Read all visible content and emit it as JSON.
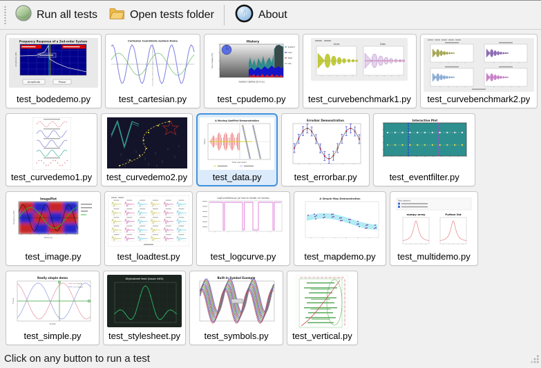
{
  "toolbar": {
    "buttons": [
      {
        "label": "Run all tests",
        "icon": "run-sphere-icon"
      },
      {
        "label": "Open tests folder",
        "icon": "open-folder-icon"
      },
      {
        "label": "About",
        "icon": "about-info-icon"
      }
    ]
  },
  "statusbar": {
    "message": "Click on any button to run a test"
  },
  "colors": {
    "selection_border": "#3f92e0",
    "selection_background": "#dcebfb",
    "card_background": "#ffffff",
    "window_background": "#f0f0f0"
  },
  "grid": {
    "selected_card": "test_data.py",
    "rows": [
      [
        {
          "id": "test_bodedemo.py",
          "label": "test_bodedemo.py",
          "thumb": {
            "title": "Frequency Response of a 2nd-order System",
            "ylabel": "Amplitude [dB]",
            "legend": [
              "Amplitude",
              "Phase"
            ]
          }
        },
        {
          "id": "test_cartesian.py",
          "label": "test_cartesian.py",
          "thumb": {
            "title": "Cartesian Coordinate System Demo"
          }
        },
        {
          "id": "test_cpudemo.py",
          "label": "test_cpudemo.py",
          "thumb": {
            "title": "History",
            "xlabel": "System Uptime [h:m:s]",
            "ylabel": "Cpu Usage [%]",
            "legend": [
              "System",
              "User",
              "Total",
              "Idle"
            ]
          }
        },
        {
          "id": "test_curvebenchmark1.py",
          "label": "test_curvebenchmark1.py",
          "thumb": {
            "titles": [
              "Lines",
              "Dots"
            ]
          }
        },
        {
          "id": "test_curvebenchmark2.py",
          "label": "test_curvebenchmark2.py",
          "thumb": {}
        }
      ],
      [
        {
          "id": "test_curvedemo1.py",
          "label": "test_curvedemo1.py",
          "thumb": {}
        },
        {
          "id": "test_curvedemo2.py",
          "label": "test_curvedemo2.py",
          "thumb": {}
        },
        {
          "id": "test_data.py",
          "label": "test_data.py",
          "selected": true,
          "thumb": {
            "title": "A Moving QwtPlot Demonstration",
            "xlabel": "Time (seconds)",
            "ylabel": "Values"
          }
        },
        {
          "id": "test_errorbar.py",
          "label": "test_errorbar.py",
          "thumb": {
            "title": "Errorbar Demonstration"
          }
        },
        {
          "id": "test_eventfilter.py",
          "label": "test_eventfilter.py",
          "thumb": {
            "title": "Interactive Plot"
          }
        }
      ],
      [
        {
          "id": "test_image.py",
          "label": "test_image.py",
          "thumb": {
            "title": "ImagePlot",
            "xlabel": "time (s)",
            "ylabel": "Frequency (Hz)"
          }
        },
        {
          "id": "test_loadtest.py",
          "label": "test_loadtest.py",
          "thumb": {}
        },
        {
          "id": "test_logcurve.py",
          "label": "test_logcurve.py",
          "thumb": {
            "title": "LogCurveDemo.py (or how to handle -inf values)"
          }
        },
        {
          "id": "test_mapdemo.py",
          "label": "test_mapdemo.py",
          "thumb": {
            "title": "A Simple Map Demonstration"
          }
        },
        {
          "id": "test_multidemo.py",
          "label": "test_multidemo.py",
          "thumb": {
            "header": "Test options",
            "titles": [
              "numpy array",
              "Python list"
            ]
          }
        }
      ],
      [
        {
          "id": "test_simple.py",
          "label": "test_simple.py",
          "thumb": {
            "title": "Really simple demo",
            "xlabel": "X-axis",
            "ylabel": "Y-axis",
            "legend": [
              "y = sin(x)",
              "y = cos(x)"
            ]
          }
        },
        {
          "id": "test_stylesheet.py",
          "label": "test_stylesheet.py",
          "thumb": {
            "title": "Stylesheet test (issue #63)"
          }
        },
        {
          "id": "test_symbols.py",
          "label": "test_symbols.py",
          "thumb": {
            "title": "Built-in Symbol Example"
          }
        },
        {
          "id": "test_vertical.py",
          "label": "test_vertical.py",
          "thumb": {}
        }
      ]
    ]
  }
}
